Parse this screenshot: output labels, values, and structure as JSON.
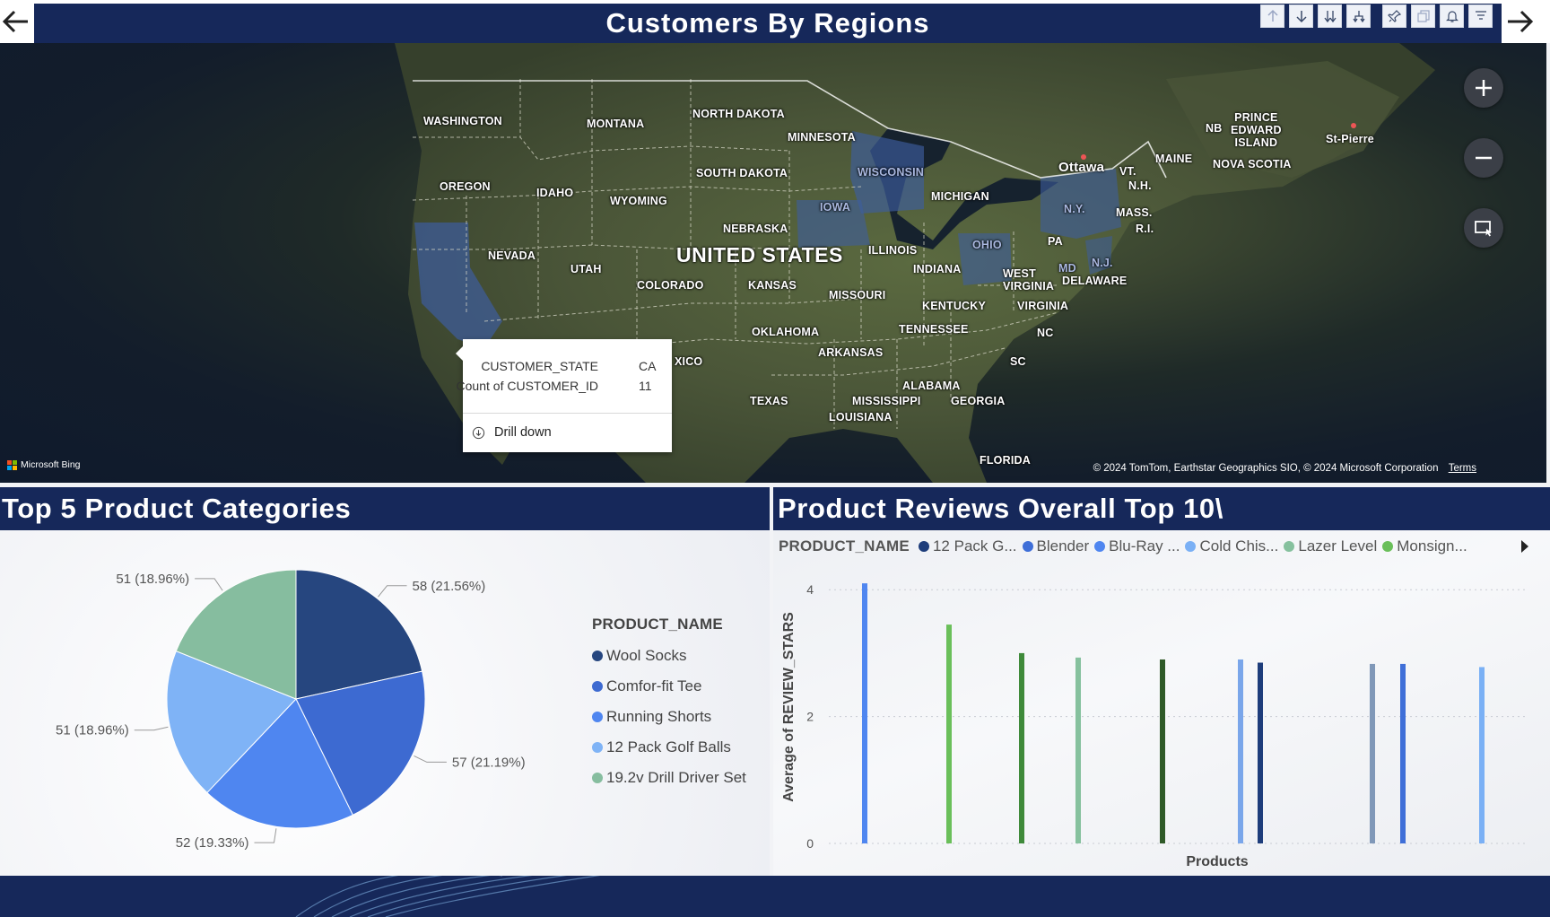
{
  "header": {
    "title": "Customers By Regions",
    "back_icon": "arrow-left-icon",
    "forward_icon": "arrow-right-icon",
    "toolbar_icons": [
      "arrow-up-icon",
      "arrow-down-icon",
      "double-arrow-down-icon",
      "expand-hierarchy-icon",
      "pin-icon",
      "copy-icon",
      "bell-icon",
      "filter-icon"
    ]
  },
  "map": {
    "labels": {
      "united_states": "UNITED STATES",
      "washington": "WASHINGTON",
      "montana": "MONTANA",
      "north_dakota": "NORTH DAKOTA",
      "minnesota": "MINNESOTA",
      "oregon": "OREGON",
      "idaho": "IDAHO",
      "wyoming": "WYOMING",
      "south_dakota": "SOUTH DAKOTA",
      "wisconsin": "WISCONSIN",
      "michigan": "MICHIGAN",
      "iowa": "IOWA",
      "nebraska": "NEBRASKA",
      "nevada": "NEVADA",
      "utah": "UTAH",
      "colorado": "COLORADO",
      "kansas": "KANSAS",
      "illinois": "ILLINOIS",
      "indiana": "INDIANA",
      "ohio": "OHIO",
      "pa": "PA",
      "ny": "N.Y.",
      "missouri": "MISSOURI",
      "kentucky": "KENTUCKY",
      "west_virginia": "WEST\nVIRGINIA",
      "virginia": "VIRGINIA",
      "delaware": "DELAWARE",
      "md": "MD",
      "nj": "N.J.",
      "oklahoma": "OKLAHOMA",
      "tennessee": "TENNESSEE",
      "nc": "NC",
      "arkansas": "ARKANSAS",
      "sc": "SC",
      "alabama": "ALABAMA",
      "texas": "TEXAS",
      "mississippi": "MISSISSIPPI",
      "georgia": "GEORGIA",
      "louisiana": "LOUISIANA",
      "florida": "FLORIDA",
      "mexico_partial": "XICO",
      "maine": "MAINE",
      "vt": "VT.",
      "nh": "N.H.",
      "mass": "MASS.",
      "ri": "R.I.",
      "nb": "NB",
      "pei": "PRINCE\nEDWARD\nISLAND",
      "nova_scotia": "NOVA SCOTIA",
      "st_pierre": "St-Pierre",
      "ottawa": "Ottawa"
    },
    "attribution": "© 2024 TomTom, Earthstar Geographics SIO, © 2024 Microsoft Corporation",
    "terms": "Terms",
    "bing_label": "Microsoft Bing",
    "controls": [
      "plus-icon",
      "minus-icon",
      "select-region-icon"
    ],
    "tooltip": {
      "rows": [
        {
          "key": "CUSTOMER_STATE",
          "value": "CA"
        },
        {
          "key": "Count of CUSTOMER_ID",
          "value": "11"
        }
      ],
      "drill_label": "Drill down"
    }
  },
  "pie_section": {
    "title": "Top 5 Product Categories",
    "legend_title": "PRODUCT_NAME"
  },
  "bar_section": {
    "title": "Product Reviews Overall Top 10\\",
    "legend_title": "PRODUCT_NAME",
    "legend_items": [
      {
        "label": "12 Pack G...",
        "color": "#1e3d7b"
      },
      {
        "label": "Blender",
        "color": "#3f6fd8"
      },
      {
        "label": "Blu-Ray ...",
        "color": "#4f86f0"
      },
      {
        "label": "Cold Chis...",
        "color": "#7ab0f5"
      },
      {
        "label": "Lazer Level",
        "color": "#86c19e"
      },
      {
        "label": "Monsign...",
        "color": "#6abf5a"
      }
    ]
  },
  "chart_data": [
    {
      "type": "pie",
      "legend_title": "PRODUCT_NAME",
      "slices": [
        {
          "name": "Wool Socks",
          "value": 58,
          "label": "58 (21.56%)",
          "color": "#26467f"
        },
        {
          "name": "Comfor-fit Tee",
          "value": 57,
          "label": "57 (21.19%)",
          "color": "#3d6ad1"
        },
        {
          "name": "Running Shorts",
          "value": 52,
          "label": "52 (19.33%)",
          "color": "#4f86f0"
        },
        {
          "name": "12 Pack Golf Balls",
          "value": 51,
          "label": "51 (18.96%)",
          "color": "#7fb3f6"
        },
        {
          "name": "19.2v Drill Driver Set",
          "value": 51,
          "label": "51 (18.96%)",
          "color": "#86bd9f"
        }
      ]
    },
    {
      "type": "bar",
      "xlabel": "Products",
      "ylabel": "Average of REVIEW_STARS",
      "ylim": [
        0,
        4.3
      ],
      "yticks": [
        0,
        2,
        4
      ],
      "grid": true,
      "bars": [
        {
          "value": 4.1,
          "color": "#4f86f0"
        },
        {
          "value": 3.45,
          "color": "#6abf5a"
        },
        {
          "value": 3.0,
          "color": "#3f8a3a"
        },
        {
          "value": 2.93,
          "color": "#86c19e"
        },
        {
          "value": 2.9,
          "color": "#2f5a28"
        },
        {
          "value": 2.9,
          "color": "#7aa6ea"
        },
        {
          "value": 2.85,
          "color": "#1e3d7b"
        },
        {
          "value": 2.83,
          "color": "#8098b8"
        },
        {
          "value": 2.83,
          "color": "#3f6fd8"
        },
        {
          "value": 2.78,
          "color": "#7ab0f5"
        }
      ]
    }
  ]
}
